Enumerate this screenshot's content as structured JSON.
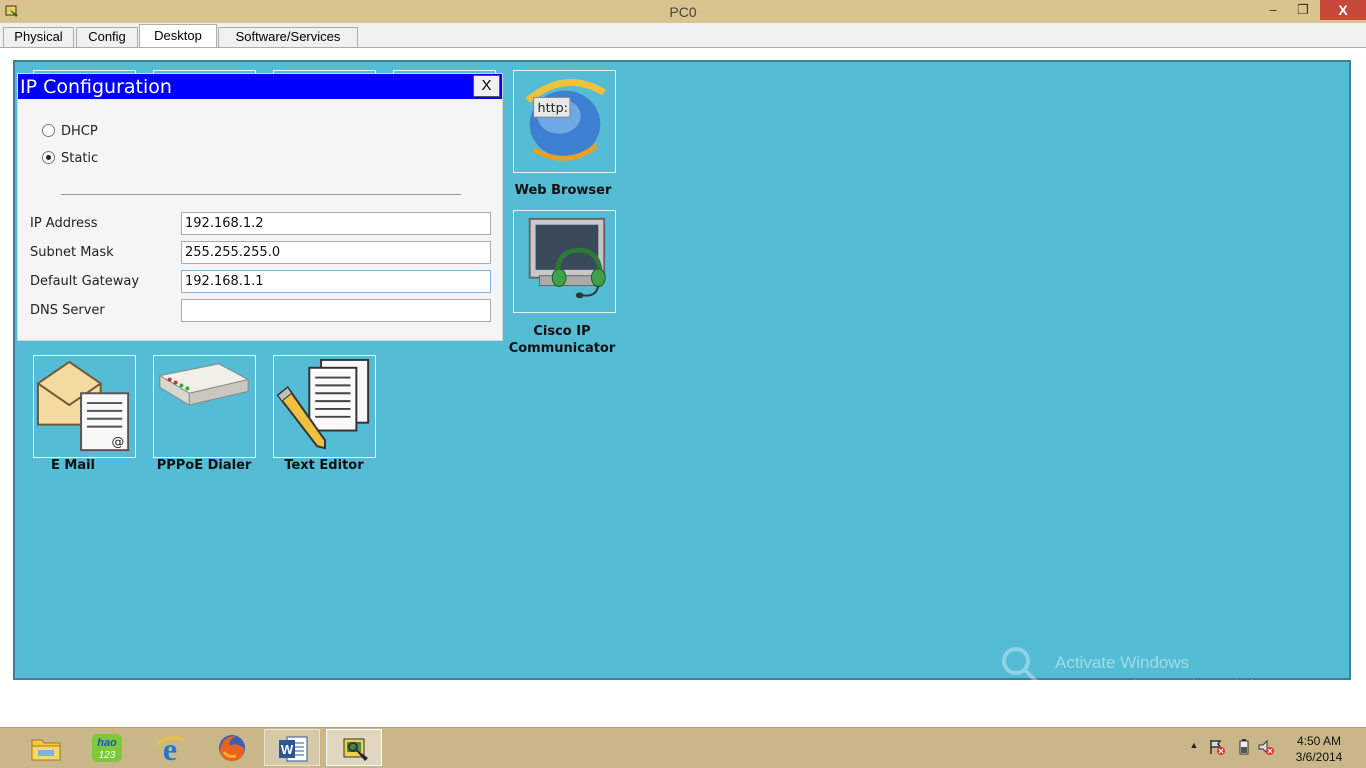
{
  "window": {
    "title": "PC0",
    "icon": "packet-tracer-icon",
    "minimize": "–",
    "maximize": "❐",
    "close": "X"
  },
  "tabs": [
    {
      "label": "Physical",
      "active": false
    },
    {
      "label": "Config",
      "active": false
    },
    {
      "label": "Desktop",
      "active": true
    },
    {
      "label": "Software/Services",
      "active": false
    }
  ],
  "desktop_apps": {
    "web_browser": {
      "label": "Web Browser",
      "icon": "web-browser-icon",
      "icon_text": "http:"
    },
    "cisco_ip": {
      "label_line1": "Cisco IP",
      "label_line2": "Communicator",
      "icon": "headset-monitor-icon"
    },
    "email": {
      "label": "E Mail",
      "icon": "email-icon"
    },
    "pppoe": {
      "label": "PPPoE Dialer",
      "icon": "dialer-device-icon"
    },
    "text_editor": {
      "label": "Text Editor",
      "icon": "text-editor-icon"
    }
  },
  "ip_config": {
    "title": "IP Configuration",
    "close_label": "X",
    "mode_options": [
      {
        "label": "DHCP",
        "selected": false
      },
      {
        "label": "Static",
        "selected": true
      }
    ],
    "fields": [
      {
        "label": "IP Address",
        "value": "192.168.1.2"
      },
      {
        "label": "Subnet Mask",
        "value": "255.255.255.0"
      },
      {
        "label": "Default Gateway",
        "value": "192.168.1.1"
      },
      {
        "label": "DNS Server",
        "value": ""
      }
    ]
  },
  "watermark": {
    "line1": "Activate Windows",
    "line2": "Go to PC settings to activate Windows."
  },
  "taskbar": {
    "items": [
      {
        "name": "file-explorer-icon"
      },
      {
        "name": "hao123-icon",
        "text_line1": "hao",
        "text_line2": "123"
      },
      {
        "name": "internet-explorer-icon"
      },
      {
        "name": "firefox-icon"
      },
      {
        "name": "word-icon",
        "text": "W"
      },
      {
        "name": "packet-tracer-icon"
      }
    ],
    "tray": {
      "chevron": "▲",
      "time": "4:50 AM",
      "date": "3/6/2014"
    }
  },
  "colors": {
    "desktop_bg": "#54bcd4",
    "titlebar": "#d9c48f",
    "dialog_title": "#0000ff",
    "close_button": "#c7493a"
  }
}
